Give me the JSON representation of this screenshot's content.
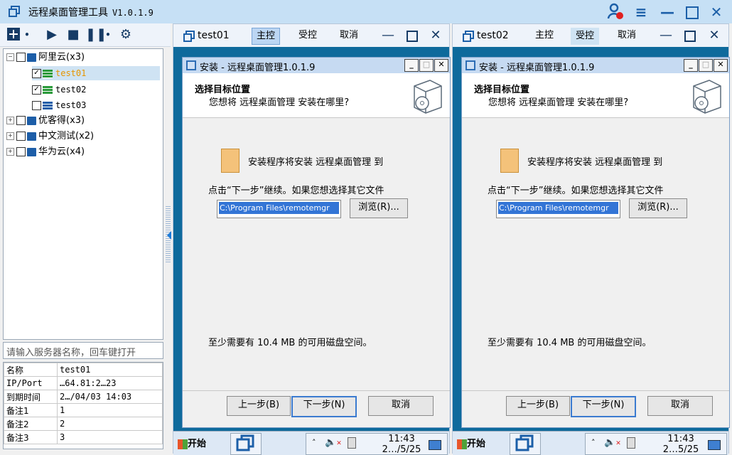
{
  "app": {
    "title": "远程桌面管理工具",
    "version": "V1.0.1.9"
  },
  "left": {
    "groups": [
      {
        "label": "阿里云(x3)",
        "expanded": true,
        "servers": [
          {
            "name": "test01",
            "checked": true,
            "online": true,
            "selected": true
          },
          {
            "name": "test02",
            "checked": true,
            "online": true,
            "selected": false
          },
          {
            "name": "test03",
            "checked": false,
            "online": false,
            "selected": false
          }
        ]
      },
      {
        "label": "优客得(x3)",
        "expanded": false
      },
      {
        "label": "中文测试(x2)",
        "expanded": false
      },
      {
        "label": "华为云(x4)",
        "expanded": false
      }
    ],
    "search_placeholder": "请输入服务器名称，回车键打开",
    "info": [
      {
        "key": "名称",
        "value": "test01"
      },
      {
        "key": "IP/Port",
        "value": "…64.81:2…23"
      },
      {
        "key": "到期时间",
        "value": "2…/04/03 14:03"
      },
      {
        "key": "备注1",
        "value": "1"
      },
      {
        "key": "备注2",
        "value": "2"
      },
      {
        "key": "备注3",
        "value": "3"
      }
    ]
  },
  "tabs_labels": {
    "host": "主控",
    "guest": "受控",
    "cancel": "取消"
  },
  "panes": [
    {
      "name": "test01",
      "active_tab": "host",
      "clock_time": "11:43",
      "clock_date": "2…/5/25"
    },
    {
      "name": "test02",
      "active_tab": "guest",
      "clock_time": "11:43",
      "clock_date": "2…5/25"
    }
  ],
  "installer": {
    "title": "安装 - 远程桌面管理1.0.1.9",
    "heading": "选择目标位置",
    "subheading": "您想将 远程桌面管理 安装在哪里?",
    "folder_line": "安装程序将安装 远程桌面管理 到",
    "next_hint": "点击“下一步”继续。如果您想选择其它文件",
    "path": "C:\\Program Files\\remotemgr",
    "browse": "浏览(R)...",
    "space": "至少需要有 10.4 MB 的可用磁盘空间。",
    "back": "上一步(B)",
    "next": "下一步(N)",
    "cancel": "取消"
  },
  "taskbar": {
    "start": "开始"
  },
  "colors": {
    "titlebar": "#c6e0f5",
    "accent": "#1c5fa8",
    "remote_bg": "#0e6a9c",
    "selection": "#3375d6"
  }
}
